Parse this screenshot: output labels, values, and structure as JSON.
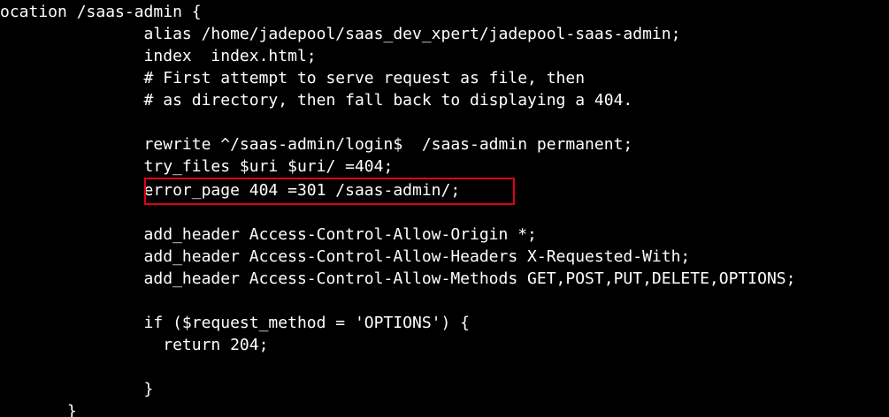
{
  "terminal": {
    "lines": [
      "ocation /saas-admin {",
      "               alias /home/jadepool/saas_dev_xpert/jadepool-saas-admin;",
      "               index  index.html;",
      "               # First attempt to serve request as file, then",
      "               # as directory, then fall back to displaying a 404.",
      "",
      "               rewrite ^/saas-admin/login$  /saas-admin permanent;",
      "               try_files $uri $uri/ =404;",
      "               error_page 404 =301 /saas-admin/;",
      "",
      "               add_header Access-Control-Allow-Origin *;",
      "               add_header Access-Control-Allow-Headers X-Requested-With;",
      "               add_header Access-Control-Allow-Methods GET,POST,PUT,DELETE,OPTIONS;",
      "",
      "               if ($request_method = 'OPTIONS') {",
      "                 return 204;",
      "",
      "               }",
      "       }"
    ]
  },
  "highlight": {
    "color": "#e0001b",
    "line_index": 8
  },
  "colors": {
    "background": "#000000",
    "text": "#ffffff"
  }
}
